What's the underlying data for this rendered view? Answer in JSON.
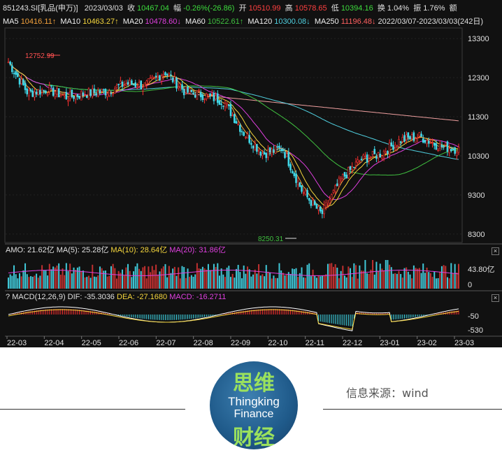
{
  "header": {
    "code": "851243.SI[乳品(申万)]",
    "date": "2023/03/03",
    "close_label": "收",
    "close_value": "10467.04",
    "change_label": "幅",
    "change_value": "-0.26%(-26.86)",
    "open_label": "开",
    "open_value": "10510.99",
    "high_label": "高",
    "high_value": "10578.65",
    "low_label": "低",
    "low_value": "10394.16",
    "turnover_label": "换",
    "turnover_value": "1.04%",
    "amplitude_label": "振",
    "amplitude_value": "1.76%",
    "amount_label": "额"
  },
  "ma_legend": [
    {
      "label": "MA5",
      "value": "10416.11↑",
      "color": "#f0f0f0"
    },
    {
      "label": "MA10",
      "value": "10463.27↑",
      "color": "#f5d63d"
    },
    {
      "label": "MA20",
      "value": "10478.60↓",
      "color": "#e040e0"
    },
    {
      "label": "MA60",
      "value": "10522.61↑",
      "color": "#40c040"
    },
    {
      "label": "MA120",
      "value": "10300.08↓",
      "color": "#50d0e0"
    },
    {
      "label": "MA250",
      "value": "11196.48↓",
      "color": "#f0a0a0"
    }
  ],
  "range_label": "2022/03/07-2023/03/03(242日)",
  "annotations": {
    "high_mark": "12752.99",
    "low_mark": "8250.31"
  },
  "amo_panel": {
    "label": "AMO: 21.62亿",
    "ma5": "MA(5): 25.28亿",
    "ma10": "MA(10): 28.64亿",
    "ma20": "MA(20): 31.86亿",
    "ticks": [
      "43.80亿",
      "0"
    ]
  },
  "macd_panel": {
    "help": "?",
    "label": "MACD(12,26,9)",
    "dif": "DIF: -35.3036",
    "dea": "DEA: -27.1680",
    "macd": "MACD: -16.2711",
    "ticks": [
      "-50",
      "-530"
    ]
  },
  "close_glyph": "×",
  "chart_data": {
    "type": "candlestick",
    "y_ticks": [
      13300,
      12300,
      11300,
      10300,
      9300,
      8300
    ],
    "ylim": [
      8100,
      13500
    ],
    "x_ticks": [
      "22-03",
      "22-04",
      "22-05",
      "22-06",
      "22-07",
      "22-08",
      "22-09",
      "22-10",
      "22-11",
      "22-12",
      "23-01",
      "23-02",
      "23-03"
    ],
    "close_path": [
      {
        "x": "22-03",
        "y": 12700
      },
      {
        "x": "22-03b",
        "y": 11900
      },
      {
        "x": "22-04",
        "y": 12000
      },
      {
        "x": "22-04b",
        "y": 11800
      },
      {
        "x": "22-05",
        "y": 11900
      },
      {
        "x": "22-05b",
        "y": 11950
      },
      {
        "x": "22-06",
        "y": 12150
      },
      {
        "x": "22-06b",
        "y": 12100
      },
      {
        "x": "22-07",
        "y": 12450
      },
      {
        "x": "22-07b",
        "y": 11950
      },
      {
        "x": "22-08",
        "y": 11850
      },
      {
        "x": "22-08b",
        "y": 11700
      },
      {
        "x": "22-09",
        "y": 10900
      },
      {
        "x": "22-09b",
        "y": 10350
      },
      {
        "x": "22-10",
        "y": 10500
      },
      {
        "x": "22-10b",
        "y": 9400
      },
      {
        "x": "22-11",
        "y": 8800
      },
      {
        "x": "22-11b",
        "y": 9700
      },
      {
        "x": "22-12",
        "y": 10200
      },
      {
        "x": "22-12b",
        "y": 10350
      },
      {
        "x": "23-01",
        "y": 10700
      },
      {
        "x": "23-01b",
        "y": 10800
      },
      {
        "x": "23-02",
        "y": 10550
      },
      {
        "x": "23-03",
        "y": 10467
      }
    ]
  },
  "footer": {
    "source": "信息来源：wind",
    "logo_cn_top": "思维",
    "logo_en_1": "Thingking",
    "logo_en_2": "Finance",
    "logo_cn_bottom": "财经"
  }
}
